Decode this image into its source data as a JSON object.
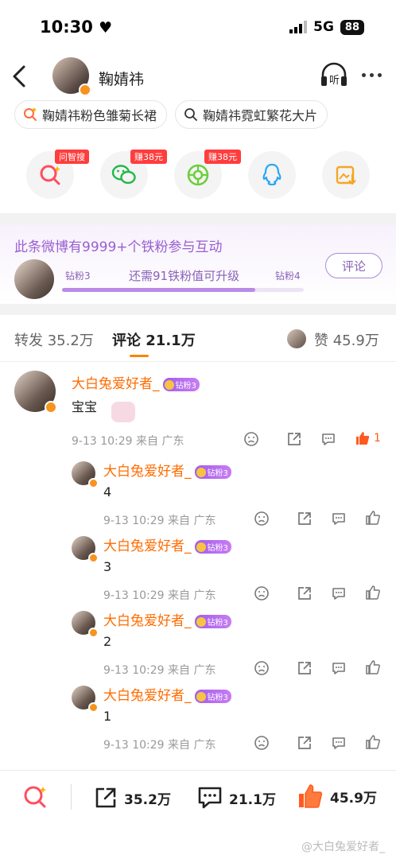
{
  "status_bar": {
    "time": "10:30",
    "network": "5G",
    "battery": "88"
  },
  "header": {
    "title": "鞠婧祎",
    "listen_label": "听"
  },
  "search_chips": [
    {
      "label": "鞠婧祎粉色雏菊长裙"
    },
    {
      "label": "鞠婧祎霓虹繁花大片"
    }
  ],
  "share_items": [
    {
      "badge": "问智搜",
      "icon": "smart-search-icon"
    },
    {
      "badge": "赚38元",
      "icon": "wechat-icon"
    },
    {
      "badge": "赚38元",
      "icon": "moments-icon"
    },
    {
      "badge": "",
      "icon": "qq-icon"
    },
    {
      "badge": "",
      "icon": "save-image-icon"
    }
  ],
  "fans_card": {
    "title": "此条微博有9999+个铁粉参与互动",
    "level_current": "钻粉3",
    "level_next": "钻粉4",
    "progress_text": "还需91铁粉值可升级",
    "progress": 0.8,
    "button": "评论"
  },
  "tabs": {
    "repost_label": "转发",
    "repost_count": "35.2万",
    "comment_label": "评论",
    "comment_count": "21.1万",
    "like_label": "赞",
    "like_count": "45.9万"
  },
  "main_comment": {
    "user": "大白兔爱好者_",
    "badge": "钻粉3",
    "text": "宝宝",
    "meta": "9-13 10:29 来自 广东",
    "likes": "1"
  },
  "replies": [
    {
      "user": "大白兔爱好者_",
      "badge": "钻粉3",
      "text": "4",
      "meta": "9-13 10:29 来自 广东"
    },
    {
      "user": "大白兔爱好者_",
      "badge": "钻粉3",
      "text": "3",
      "meta": "9-13 10:29 来自 广东"
    },
    {
      "user": "大白兔爱好者_",
      "badge": "钻粉3",
      "text": "2",
      "meta": "9-13 10:29 来自 广东"
    },
    {
      "user": "大白兔爱好者_",
      "badge": "钻粉3",
      "text": "1",
      "meta": "9-13 10:29 来自 广东"
    }
  ],
  "bottom_bar": {
    "repost": "35.2万",
    "comment": "21.1万",
    "like": "45.9万"
  },
  "watermark": "@大白兔爱好者_",
  "colors": {
    "accent": "#ff8200",
    "name": "#ff6c00",
    "fans": "#9a5fd0",
    "like_active": "#ff5a1f"
  }
}
